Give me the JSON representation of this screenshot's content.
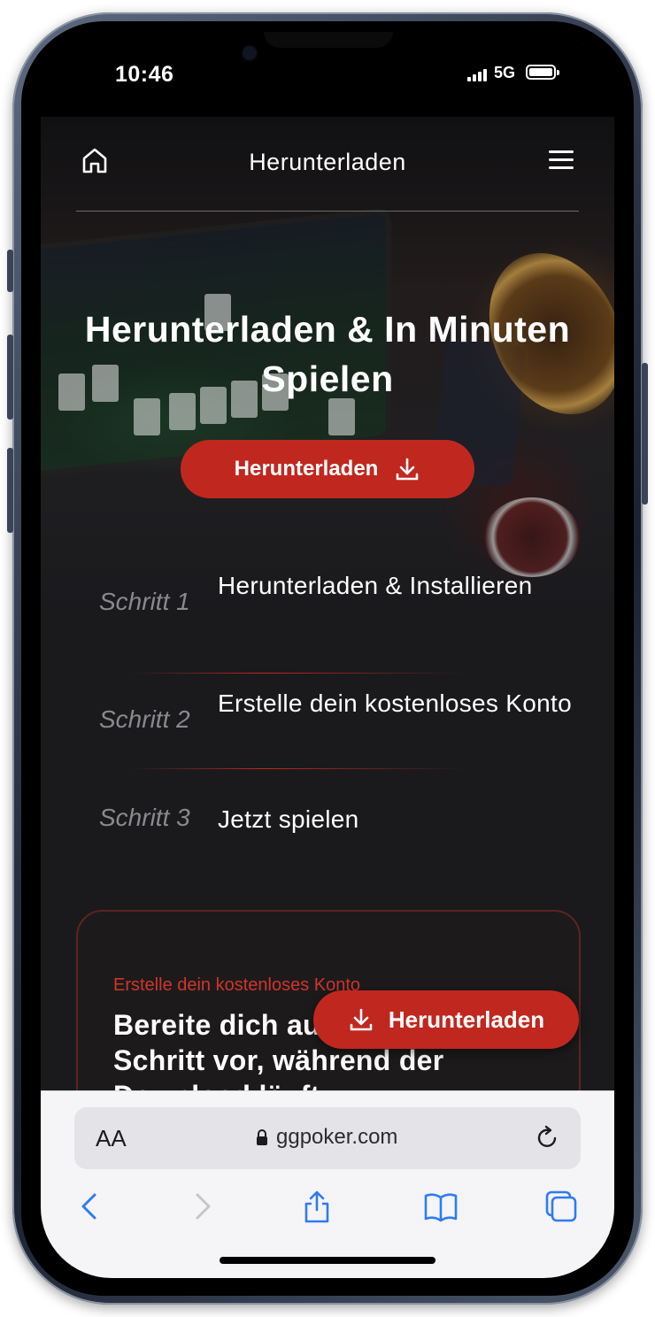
{
  "status_bar": {
    "time": "10:46",
    "network": "5G"
  },
  "nav": {
    "title": "Herunterladen"
  },
  "hero": {
    "title": "Herunterladen & In Minuten Spielen",
    "button_label": "Herunterladen"
  },
  "steps": [
    {
      "label": "Schritt 1",
      "text": "Herunterladen & Installieren"
    },
    {
      "label": "Schritt 2",
      "text": "Erstelle dein kostenloses Konto"
    },
    {
      "label": "Schritt 3",
      "text": "Jetzt spielen"
    }
  ],
  "promo": {
    "kicker": "Erstelle dein kostenloses Konto",
    "title": "Bereite dich auf den nächsten Schritt vor, während der Download läuft"
  },
  "floating_button": {
    "label": "Herunterladen"
  },
  "browser": {
    "text_size_label": "AA",
    "url": "ggpoker.com",
    "accent_color": "#2f7bf5"
  },
  "colors": {
    "brand_red": "#c0281f",
    "background": "#1a1a1d"
  }
}
